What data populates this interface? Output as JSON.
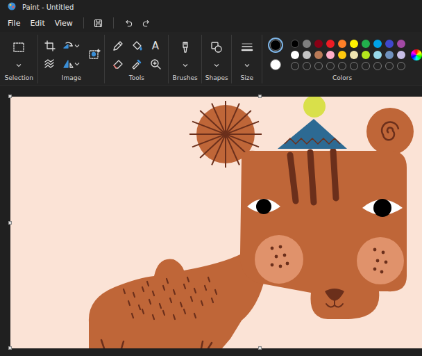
{
  "window": {
    "title": "Paint - Untitled"
  },
  "menu": [
    "File",
    "Edit",
    "View"
  ],
  "ribbon": {
    "groups": [
      {
        "label": "Selection"
      },
      {
        "label": "Image"
      },
      {
        "label": "Tools"
      },
      {
        "label": "Brushes"
      },
      {
        "label": "Shapes"
      },
      {
        "label": "Size"
      },
      {
        "label": "Colors"
      }
    ],
    "text_tool": "A"
  },
  "colors": {
    "primary": {
      "color": "#000000",
      "selected": true
    },
    "secondary": {
      "color": "#ffffff",
      "selected": false
    },
    "palette": [
      {
        "kind": "swatch",
        "color": "#000000"
      },
      {
        "kind": "swatch",
        "color": "#7f7f7f"
      },
      {
        "kind": "swatch",
        "color": "#880015"
      },
      {
        "kind": "swatch",
        "color": "#ed1c24"
      },
      {
        "kind": "swatch",
        "color": "#ff7f27"
      },
      {
        "kind": "swatch",
        "color": "#fff200"
      },
      {
        "kind": "swatch",
        "color": "#22b14c"
      },
      {
        "kind": "swatch",
        "color": "#00a2e8"
      },
      {
        "kind": "swatch",
        "color": "#3f48cc"
      },
      {
        "kind": "swatch",
        "color": "#a349a4"
      },
      {
        "kind": "swatch",
        "color": "#ffffff"
      },
      {
        "kind": "swatch",
        "color": "#c3c3c3"
      },
      {
        "kind": "swatch",
        "color": "#b97a57"
      },
      {
        "kind": "swatch",
        "color": "#ffaec9"
      },
      {
        "kind": "swatch",
        "color": "#ffc90e"
      },
      {
        "kind": "swatch",
        "color": "#efe4b0"
      },
      {
        "kind": "swatch",
        "color": "#b5e61d"
      },
      {
        "kind": "swatch",
        "color": "#99d9ea"
      },
      {
        "kind": "swatch",
        "color": "#7092be"
      },
      {
        "kind": "swatch",
        "color": "#c8bfe7"
      },
      {
        "kind": "empty"
      },
      {
        "kind": "empty"
      },
      {
        "kind": "empty"
      },
      {
        "kind": "empty"
      },
      {
        "kind": "empty"
      },
      {
        "kind": "empty"
      },
      {
        "kind": "empty"
      },
      {
        "kind": "empty"
      },
      {
        "kind": "empty"
      },
      {
        "kind": "empty"
      }
    ]
  }
}
